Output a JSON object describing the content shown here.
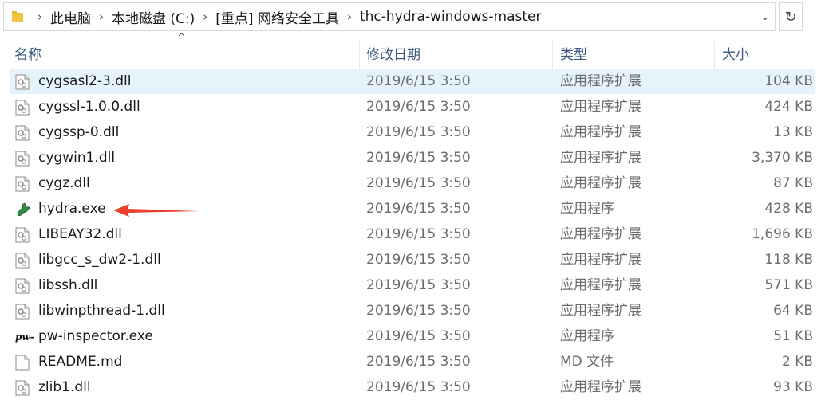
{
  "breadcrumb": [
    "此电脑",
    "本地磁盘 (C:)",
    "[重点] 网络安全工具",
    "thc-hydra-windows-master"
  ],
  "columns": {
    "name": "名称",
    "date": "修改日期",
    "type": "类型",
    "size": "大小"
  },
  "files": [
    {
      "name": "cygsasl2-3.dll",
      "date": "2019/6/15 3:50",
      "type": "应用程序扩展",
      "size": "104 KB",
      "icon": "dll-file-icon"
    },
    {
      "name": "cygssl-1.0.0.dll",
      "date": "2019/6/15 3:50",
      "type": "应用程序扩展",
      "size": "424 KB",
      "icon": "dll-file-icon"
    },
    {
      "name": "cygssp-0.dll",
      "date": "2019/6/15 3:50",
      "type": "应用程序扩展",
      "size": "13 KB",
      "icon": "dll-file-icon"
    },
    {
      "name": "cygwin1.dll",
      "date": "2019/6/15 3:50",
      "type": "应用程序扩展",
      "size": "3,370 KB",
      "icon": "dll-file-icon"
    },
    {
      "name": "cygz.dll",
      "date": "2019/6/15 3:50",
      "type": "应用程序扩展",
      "size": "87 KB",
      "icon": "dll-file-icon"
    },
    {
      "name": "hydra.exe",
      "date": "2019/6/15 3:50",
      "type": "应用程序",
      "size": "428 KB",
      "icon": "hydra-app-icon"
    },
    {
      "name": "LIBEAY32.dll",
      "date": "2019/6/15 3:50",
      "type": "应用程序扩展",
      "size": "1,696 KB",
      "icon": "dll-file-icon"
    },
    {
      "name": "libgcc_s_dw2-1.dll",
      "date": "2019/6/15 3:50",
      "type": "应用程序扩展",
      "size": "118 KB",
      "icon": "dll-file-icon"
    },
    {
      "name": "libssh.dll",
      "date": "2019/6/15 3:50",
      "type": "应用程序扩展",
      "size": "571 KB",
      "icon": "dll-file-icon"
    },
    {
      "name": "libwinpthread-1.dll",
      "date": "2019/6/15 3:50",
      "type": "应用程序扩展",
      "size": "64 KB",
      "icon": "dll-file-icon"
    },
    {
      "name": "pw-inspector.exe",
      "date": "2019/6/15 3:50",
      "type": "应用程序",
      "size": "51 KB",
      "icon": "pw-inspector-app-icon"
    },
    {
      "name": "README.md",
      "date": "2019/6/15 3:50",
      "type": "MD 文件",
      "size": "2 KB",
      "icon": "text-file-icon"
    },
    {
      "name": "zlib1.dll",
      "date": "2019/6/15 3:50",
      "type": "应用程序扩展",
      "size": "93 KB",
      "icon": "dll-file-icon"
    }
  ],
  "selected_index": 0,
  "annotation": {
    "target_file": "hydra.exe",
    "arrow_color": "#e8412f"
  },
  "colors": {
    "selected_row": "#e5f3fb",
    "header_text": "#3c5a80"
  }
}
